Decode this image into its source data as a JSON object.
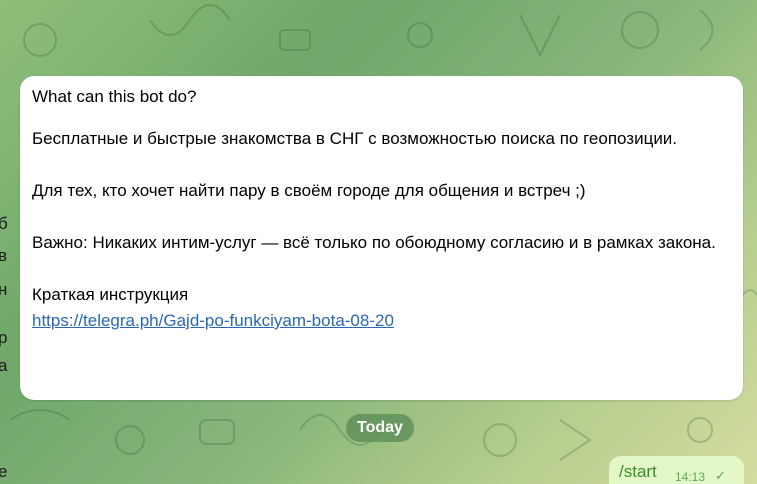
{
  "bot_info": {
    "title": "What can this bot do?",
    "paragraph_1": "Бесплатные и быстрые знакомства в СНГ с возможностью поиска по геопозиции.",
    "paragraph_2": "Для тех, кто хочет найти пару в своём городе для общения и встреч ;)",
    "paragraph_3": "Важно: Никаких интим-услуг — всё только по обоюдному согласию и в рамках закона.",
    "instruction_label": "Краткая инструкция",
    "instruction_link": "https://telegra.ph/Gajd-po-funkciyam-bota-08-20"
  },
  "date_separator": "Today",
  "outgoing_message": {
    "text": "/start",
    "time": "14:13",
    "status_icon": "check-icon"
  },
  "left_edge_fragments": [
    "б",
    "в",
    "н",
    "р",
    "а",
    "е"
  ],
  "colors": {
    "link": "#2a68b5",
    "outgoing_bubble": "#e3f7c7",
    "outgoing_text": "#3b8c2e",
    "date_pill": "#588a54"
  }
}
